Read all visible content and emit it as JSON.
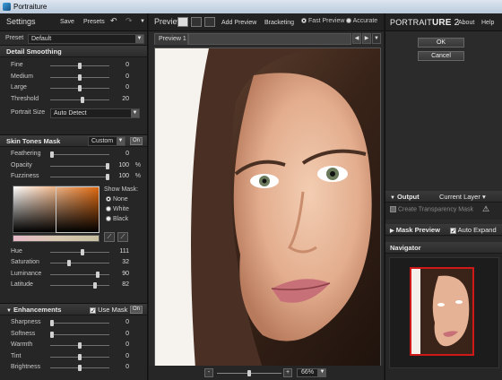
{
  "window": {
    "title": "Portraiture"
  },
  "left": {
    "title": "Settings",
    "save": "Save",
    "presets": "Presets",
    "undo_icon": "undo-icon",
    "redo_icon": "redo-icon",
    "preset_label": "Preset",
    "preset_value": "Default",
    "detail": {
      "header": "Detail Smoothing",
      "rows": [
        {
          "label": "Fine",
          "value": "0"
        },
        {
          "label": "Medium",
          "value": "0"
        },
        {
          "label": "Large",
          "value": "0"
        },
        {
          "label": "Threshold",
          "value": "20"
        }
      ],
      "levels": [
        0.5,
        0.5,
        0.5,
        0.55
      ],
      "portrait_size_label": "Portrait Size",
      "portrait_size_value": "Auto Detect"
    },
    "skin": {
      "header": "Skin Tones Mask",
      "mode": "Custom",
      "on": "On",
      "rows": [
        {
          "label": "Feathering",
          "value": "0",
          "pct": ""
        },
        {
          "label": "Opacity",
          "value": "100",
          "pct": "%"
        },
        {
          "label": "Fuzziness",
          "value": "100",
          "pct": "%"
        }
      ],
      "levels": [
        0.0,
        1.0,
        1.0
      ],
      "show_mask": "Show Mask:",
      "opt_none": "None",
      "opt_white": "White",
      "opt_black": "Black",
      "hsl": [
        {
          "label": "Hue",
          "value": "111"
        },
        {
          "label": "Saturation",
          "value": "32"
        },
        {
          "label": "Luminance",
          "value": "90"
        },
        {
          "label": "Latitude",
          "value": "82"
        }
      ],
      "hsl_levels": [
        0.55,
        0.3,
        0.82,
        0.78
      ]
    },
    "enh": {
      "header": "Enhancements",
      "use_mask": "Use Mask",
      "on": "On",
      "rows": [
        {
          "label": "Sharpness",
          "value": "0"
        },
        {
          "label": "Softness",
          "value": "0"
        },
        {
          "label": "Warmth",
          "value": "0"
        },
        {
          "label": "Tint",
          "value": "0"
        },
        {
          "label": "Brightness",
          "value": "0"
        }
      ],
      "levels": [
        0.0,
        0.0,
        0.5,
        0.5,
        0.5
      ]
    }
  },
  "center": {
    "title": "Preview",
    "add_preview": "Add Preview",
    "bracketing": "Bracketing",
    "fast_preview": "Fast Preview",
    "accurate": "Accurate",
    "tab": "Preview 1",
    "zoom": "66%",
    "zoom_level": 0.5
  },
  "right": {
    "brand_a": "PORTRAIT",
    "brand_b": "URE",
    "brand_c": " 2",
    "about": "About",
    "help": "Help",
    "ok": "OK",
    "cancel": "Cancel",
    "output_header": "Output",
    "output_value": "Current Layer",
    "create_mask": "Create Transparency Mask",
    "mask_preview": "Mask Preview",
    "auto_expand": "Auto Expand",
    "navigator": "Navigator"
  }
}
